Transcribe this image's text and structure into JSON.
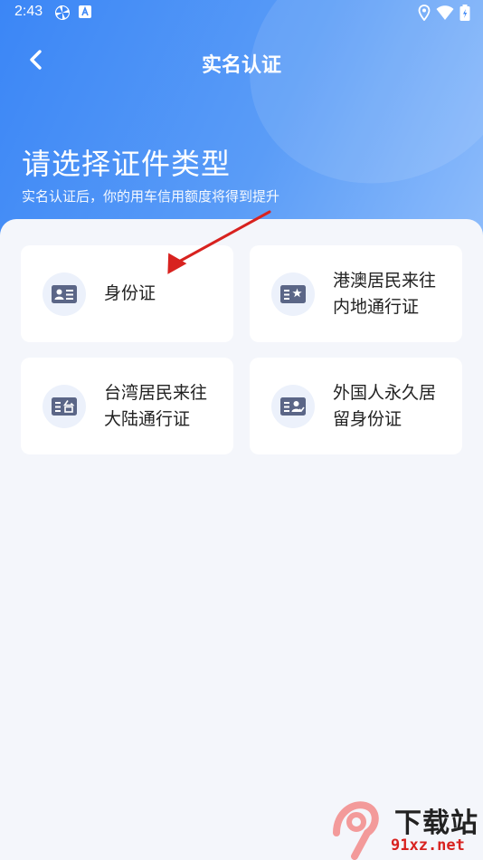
{
  "status_bar": {
    "time": "2:43",
    "icons": [
      "pinwheel-icon",
      "a-app-icon",
      "location-icon",
      "wifi-icon",
      "battery-icon"
    ]
  },
  "nav": {
    "back_icon": "chevron-left-icon",
    "title": "实名认证"
  },
  "header": {
    "heading": "请选择证件类型",
    "subheading": "实名认证后，你的用车信用额度将得到提升"
  },
  "colors": {
    "accent": "#3b86f6",
    "icon_fg": "#5b6687",
    "icon_bg": "#ecf1fb",
    "arrow": "#d8221f"
  },
  "id_types": [
    {
      "line1": "身份证",
      "line2": "",
      "icon": "id-card-icon"
    },
    {
      "line1": "港澳居民来往",
      "line2": "内地通行证",
      "icon": "hk-macau-permit-icon"
    },
    {
      "line1": "台湾居民来往",
      "line2": "大陆通行证",
      "icon": "taiwan-permit-icon"
    },
    {
      "line1": "外国人永久居",
      "line2": "留身份证",
      "icon": "foreigner-id-icon"
    }
  ],
  "watermark": {
    "text": "下载站",
    "url": "91xz.net"
  }
}
